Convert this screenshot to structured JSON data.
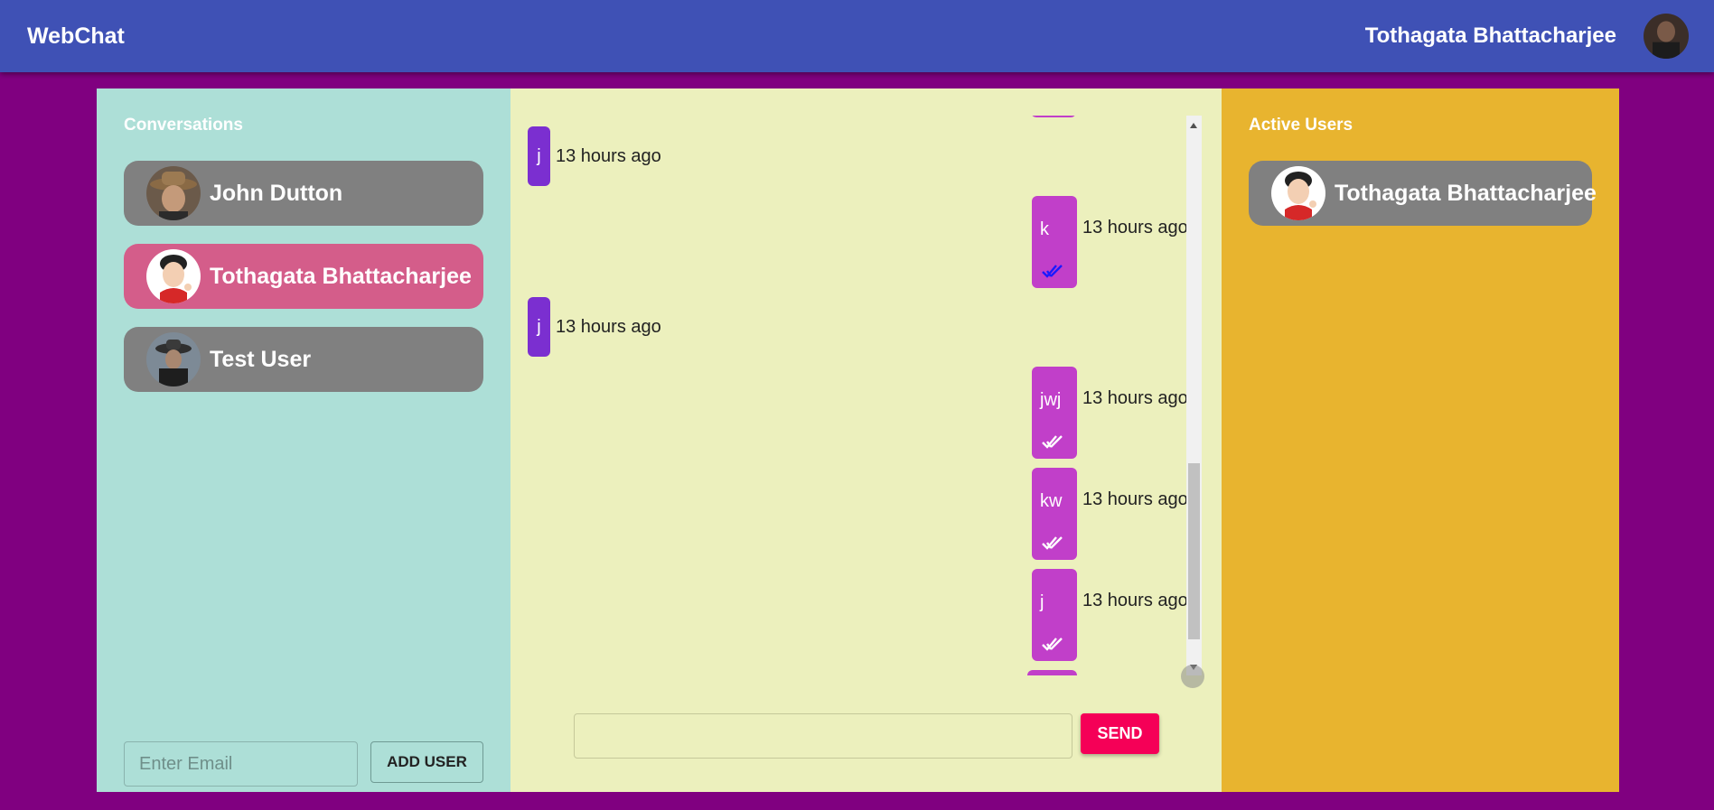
{
  "app": {
    "title": "WebChat"
  },
  "header": {
    "user_name": "Tothagata Bhattacharjee"
  },
  "conversations": {
    "title": "Conversations",
    "items": [
      {
        "name": "John Dutton",
        "selected": false
      },
      {
        "name": "Tothagata Bhattacharjee",
        "selected": true
      },
      {
        "name": "Test User",
        "selected": false
      }
    ]
  },
  "add_user": {
    "placeholder": "Enter Email",
    "button_label": "ADD USER"
  },
  "messages": [
    {
      "text": "j",
      "time": "13 hours ago",
      "direction": "in"
    },
    {
      "text": "k",
      "time": "13 hours ago",
      "direction": "out",
      "read": true
    },
    {
      "text": "j",
      "time": "13 hours ago",
      "direction": "in"
    },
    {
      "text": "jwj",
      "time": "13 hours ago",
      "direction": "out",
      "read": false
    },
    {
      "text": "kw",
      "time": "13 hours ago",
      "direction": "out",
      "read": false
    },
    {
      "text": "j",
      "time": "13 hours ago",
      "direction": "out",
      "read": false
    }
  ],
  "composer": {
    "send_label": "SEND"
  },
  "active_users": {
    "title": "Active Users",
    "items": [
      {
        "name": "Tothagata Bhattacharjee"
      }
    ]
  },
  "colors": {
    "appbar": "#3f51b5",
    "background": "#800080",
    "left_panel": "#addfd7",
    "chat_panel": "#ecf0bd",
    "right_panel": "#e8b42f",
    "selected_item": "#d45d8a",
    "outgoing_bubble": "#c13fc9",
    "incoming_bubble": "#7b2fd0",
    "send_button": "#f50057",
    "read_ticks": "#1a1aff",
    "unread_ticks": "#ffffff"
  }
}
